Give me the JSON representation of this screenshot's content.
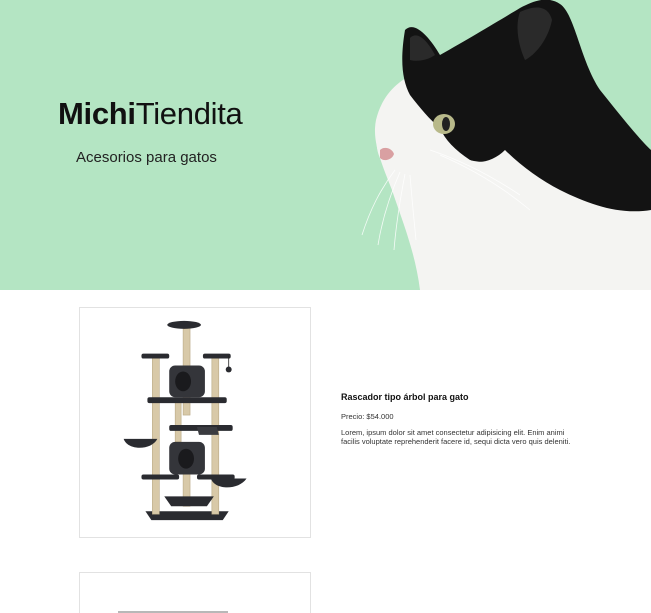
{
  "hero": {
    "brand_bold": "Michi",
    "brand_regular": "Tiendita",
    "tagline": "Acesorios para gatos",
    "background_color": "#b4e5c3",
    "image_icon": "black-and-white-cat-photo"
  },
  "products": [
    {
      "image_icon": "cat-tree-scratcher-image",
      "title": "Rascador tipo árbol para gato",
      "price": "Precio: $54.000",
      "description": "Lorem, ipsum dolor sit amet consectetur adipisicing elit. Enim animi facilis voluptate reprehenderit facere id, sequi dicta vero quis deleniti."
    },
    {
      "image_icon": "product-image"
    }
  ]
}
